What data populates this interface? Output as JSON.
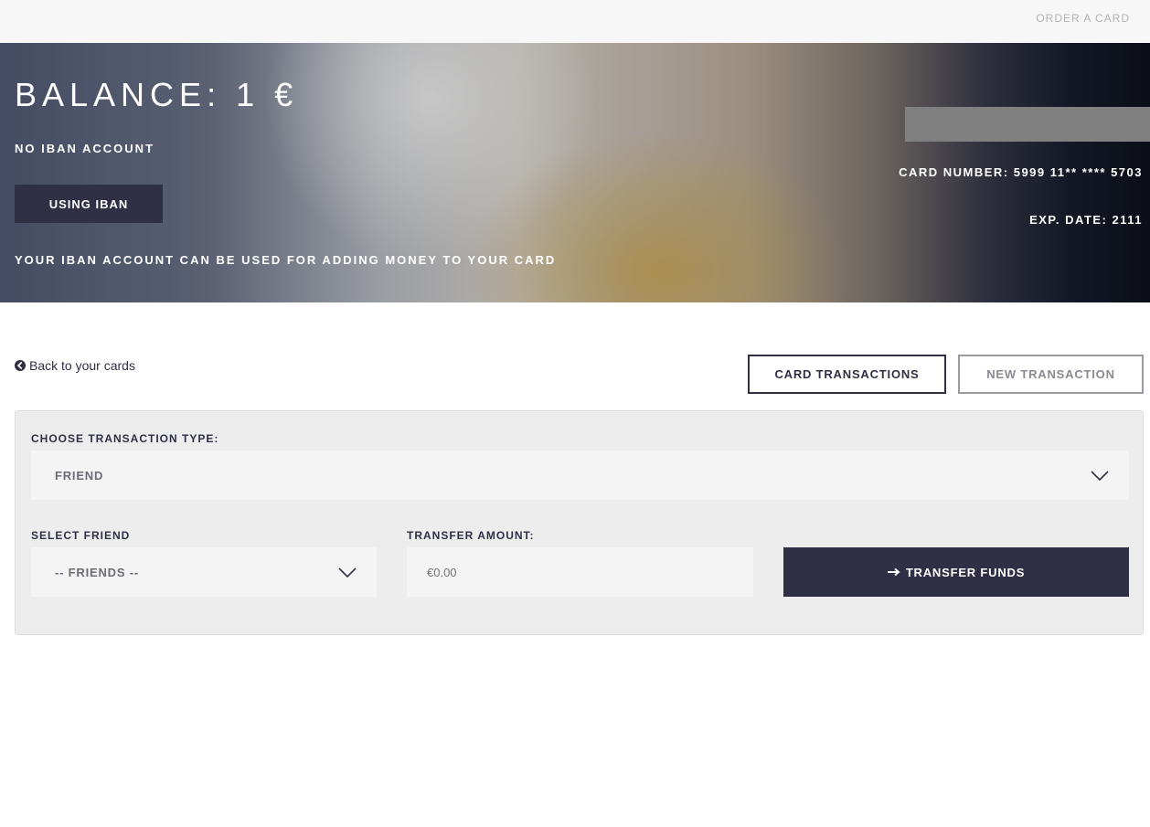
{
  "topbar": {
    "order_card": "ORDER A CARD"
  },
  "hero": {
    "balance": "BALANCE: 1 €",
    "no_iban": "NO IBAN ACCOUNT",
    "iban_button": "USING IBAN",
    "iban_note": "YOUR IBAN ACCOUNT CAN BE USED FOR ADDING MONEY TO YOUR CARD",
    "card_number": "CARD NUMBER: 5999 11** **** 5703",
    "exp_date": "EXP. DATE: 2111"
  },
  "nav": {
    "back_label": "Back to your cards",
    "tab_transactions": "CARD TRANSACTIONS",
    "tab_new": "NEW TRANSACTION"
  },
  "form": {
    "type_label": "CHOOSE TRANSACTION TYPE:",
    "type_value": "FRIEND",
    "friend_label": "SELECT FRIEND",
    "friend_value": "-- FRIENDS --",
    "amount_label": "TRANSFER AMOUNT:",
    "amount_placeholder": "€0.00",
    "transfer_button": "TRANSFER FUNDS"
  },
  "colors": {
    "accent": "#2f2f45",
    "panel": "#ededed",
    "field": "#f4f4f4"
  },
  "icons": {
    "back": "circle-arrow-left-icon",
    "chevron": "chevron-down-icon",
    "transfer": "arrow-right-icon"
  }
}
